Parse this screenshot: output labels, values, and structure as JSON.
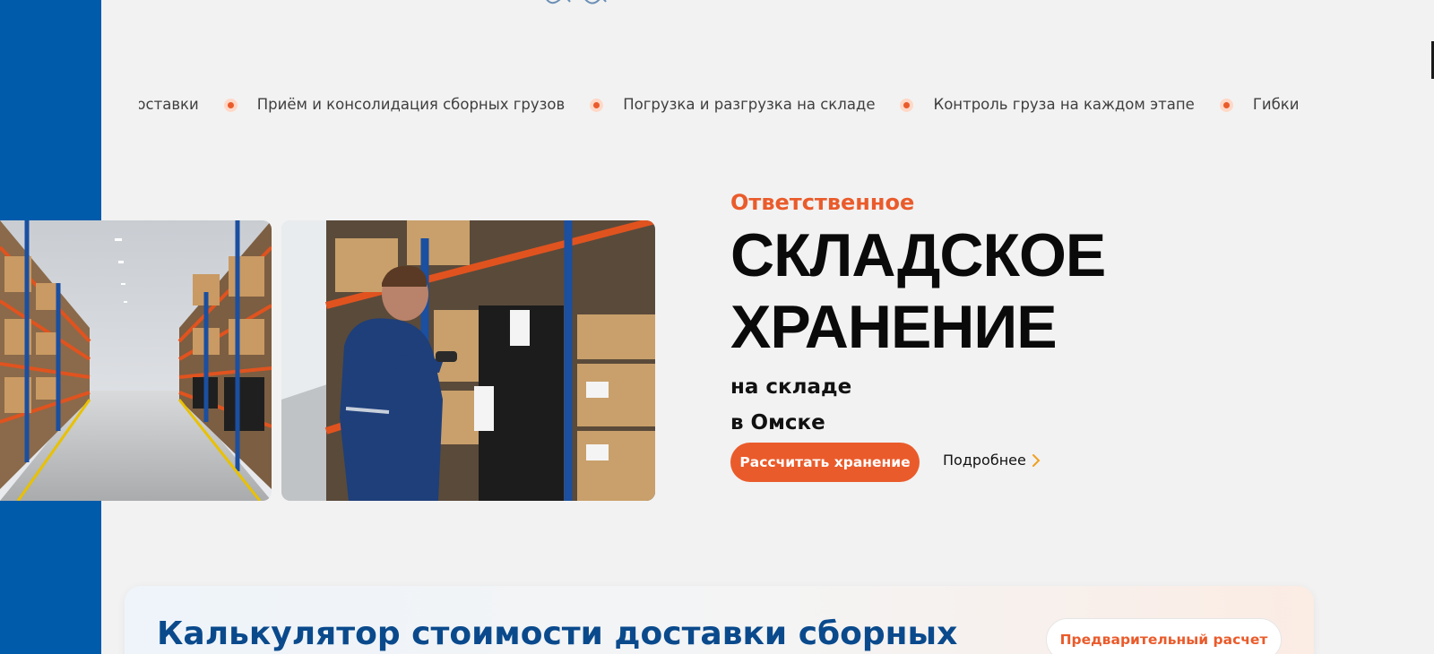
{
  "colors": {
    "accent": "#ea5b2b",
    "brand_blue": "#005bab",
    "title_blue": "#0a4a8c",
    "background": "#f2f2f2"
  },
  "marquee": {
    "items": [
      "Сроки доставки",
      "Приём и консолидация сборных грузов",
      "Погрузка и разгрузка на складе",
      "Контроль груза на каждом этапе",
      "Гибкие условия"
    ],
    "visible_start": "оставки",
    "visible_end": "Гибкие услов"
  },
  "hero": {
    "eyebrow": "Ответственное",
    "title_line1": "СКЛАДСКОЕ",
    "title_line2": "ХРАНЕНИЕ",
    "sub_line1": "на складе",
    "sub_line2": "в Омске",
    "primary_button": "Рассчитать хранение",
    "more_link": "Подробнее",
    "images": [
      "warehouse-aisle-photo",
      "worker-scanning-photo"
    ]
  },
  "calculator": {
    "title": "Калькулятор стоимости доставки сборных",
    "badge": "Предварительный расчет"
  },
  "icons": [
    "logo-icon",
    "bullet-dot-icon",
    "chevron-right-icon"
  ]
}
